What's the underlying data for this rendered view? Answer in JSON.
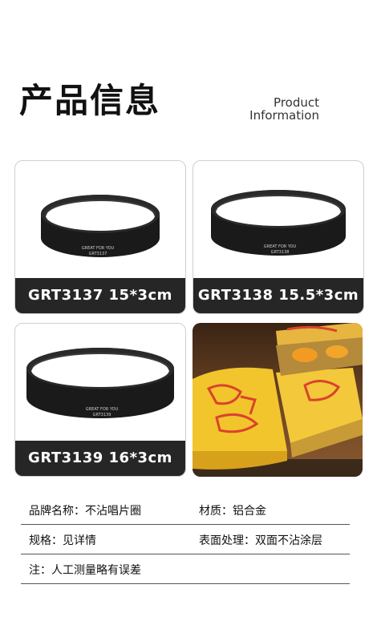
{
  "header": {
    "title_cn": "产品信息",
    "title_en_line1": "Product",
    "title_en_line2": "Information"
  },
  "products": [
    {
      "label": "GRT3137  15*3cm",
      "engraving_1": "GREAT FOR YOU",
      "engraving_2": "GRT3137"
    },
    {
      "label": "GRT3138  15.5*3cm",
      "engraving_1": "GREAT FOR YOU",
      "engraving_2": "GRT3138"
    },
    {
      "label": "GRT3139  16*3cm",
      "engraving_1": "GREAT FOR YOU",
      "engraving_2": "GRT3139"
    }
  ],
  "specs": {
    "brand": "品牌名称：不沾唱片圈",
    "material": "材质：铝合金",
    "size": "规格：见详情",
    "surface": "表面处理：双面不沾涂层",
    "note": "注：人工测量略有误差"
  },
  "colors": {
    "band": "#262626",
    "ring": "#1a1a1a",
    "cake_yellow": "#f0c42a",
    "cake_red": "#d9442c"
  }
}
